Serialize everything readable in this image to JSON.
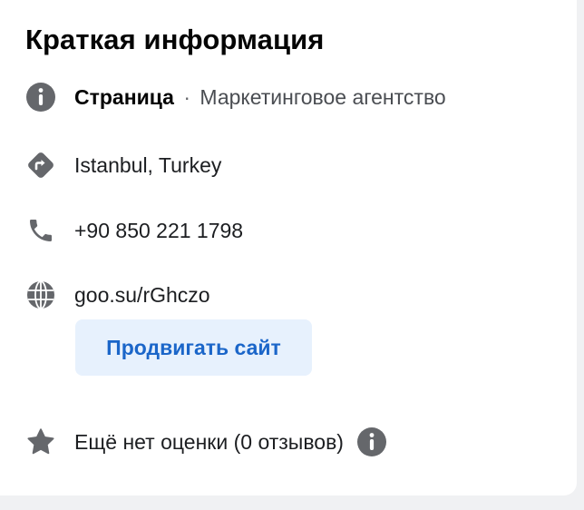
{
  "section": {
    "title": "Краткая информация"
  },
  "category": {
    "icon": "info-icon",
    "label": "Страница",
    "separator": "·",
    "value": "Маркетинговое агентство"
  },
  "address": {
    "icon": "directions-icon",
    "value": "Istanbul, Turkey"
  },
  "phone": {
    "icon": "phone-icon",
    "value": "+90 850 221 1798"
  },
  "website": {
    "icon": "globe-icon",
    "value": "goo.su/rGhczo",
    "promote_label": "Продвигать сайт"
  },
  "rating": {
    "icon": "star-icon",
    "value": "Ещё нет оценки (0 отзывов)",
    "info_icon": "info-icon"
  },
  "colors": {
    "icon_gray": "#65676b",
    "link": "#2a5db0",
    "button_bg": "#e7f1fd",
    "button_text": "#1b66c9"
  }
}
